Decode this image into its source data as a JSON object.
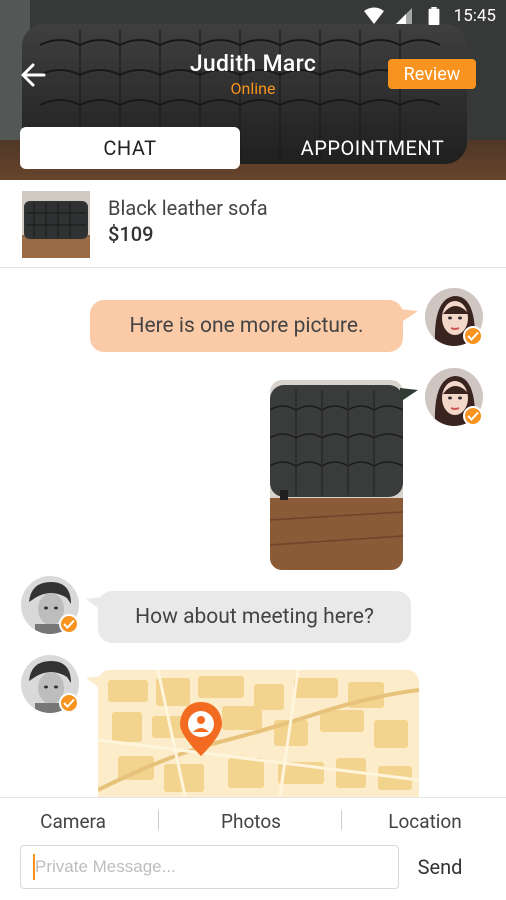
{
  "status_bar": {
    "time": "15:45"
  },
  "header": {
    "contact_name": "Judith Marc",
    "contact_status": "Online",
    "review_label": "Review",
    "tabs": [
      {
        "label": "CHAT",
        "active": true
      },
      {
        "label": "APPOINTMENT",
        "active": false
      }
    ]
  },
  "product": {
    "name": "Black leather sofa",
    "price": "$109"
  },
  "messages": [
    {
      "side": "out",
      "type": "text",
      "text": "Here is one more picture."
    },
    {
      "side": "out",
      "type": "image",
      "image": "black-leather-sofa-photo"
    },
    {
      "side": "in",
      "type": "text",
      "text": "How about meeting here?"
    },
    {
      "side": "in",
      "type": "location",
      "image": "map-with-location-pin"
    }
  ],
  "actions": [
    {
      "label": "Camera"
    },
    {
      "label": "Photos"
    },
    {
      "label": "Location"
    }
  ],
  "composer": {
    "placeholder": "Private Message...",
    "value": "",
    "send_label": "Send"
  },
  "colors": {
    "accent": "#f7931e",
    "outgoing_bubble": "#fbcba8",
    "incoming_bubble": "#e9e9e9"
  }
}
